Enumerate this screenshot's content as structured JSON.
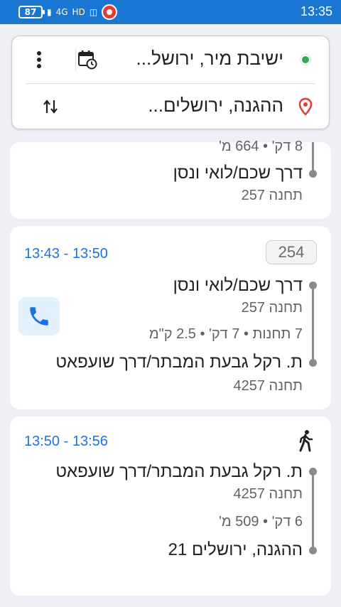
{
  "status_bar": {
    "battery": "87",
    "network": "4G",
    "hd": "HD",
    "time": "13:35"
  },
  "search": {
    "origin": "ישיבת מיר, ירושל...",
    "destination": "ההגנה, ירושלים..."
  },
  "colors": {
    "accent": "#1976d2",
    "origin_dot": "#34a853",
    "dest_pin": "#e53935",
    "time_blue": "#1a73e8"
  },
  "icons": [
    "more-options-icon",
    "schedule-calendar-icon",
    "swap-icon",
    "origin-dot-icon",
    "destination-pin-icon",
    "phone-icon",
    "walking-icon"
  ],
  "leg1": {
    "info": "8 דק' • 664 מ'",
    "stop_name": "דרך שכם/לואי ונסן",
    "stop_code": "תחנה 257"
  },
  "leg2": {
    "time_range": "13:43 - 13:50",
    "bus_number": "254",
    "start_stop": "דרך שכם/לואי ונסן",
    "start_code": "תחנה 257",
    "info": "7 תחנות • 7 דק' • 2.5 ק\"מ",
    "end_stop": "ת. רקל גבעת המבתר/דרך שועפאט",
    "end_code": "תחנה 4257"
  },
  "leg3": {
    "time_range": "13:50 - 13:56",
    "start_stop": "ת. רקל גבעת המבתר/דרך שועפאט",
    "start_code": "תחנה 4257",
    "info": "6 דק' • 509 מ'",
    "end_stop": "ההגנה, ירושלים 21"
  }
}
